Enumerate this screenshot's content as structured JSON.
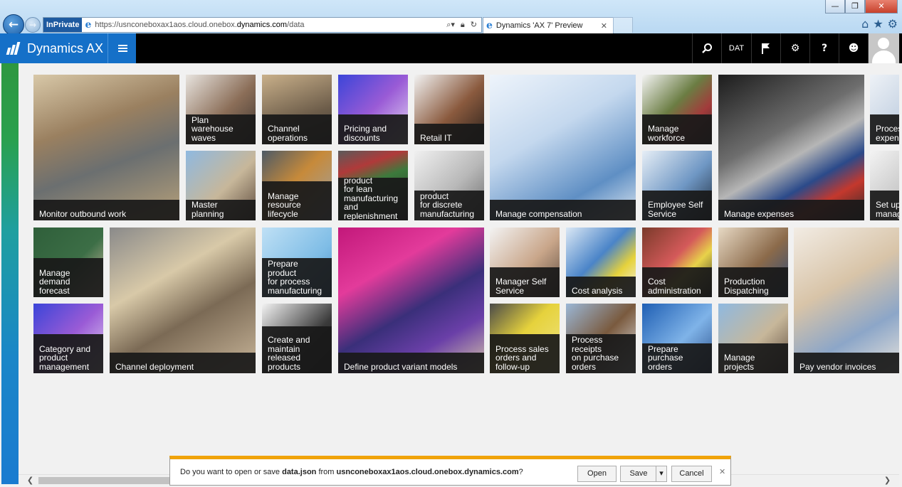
{
  "browser": {
    "inprivate": "InPrivate",
    "url_prefix": "https://usnconeboxax1aos.cloud.onebox.",
    "url_domain": "dynamics.com",
    "url_path": "/data",
    "tab_title": "Dynamics 'AX 7' Preview",
    "window_buttons": {
      "minimize": "—",
      "restore": "❐",
      "close": "✕"
    },
    "toolbar_icons": [
      "home-icon",
      "favorites-star-icon",
      "tools-gear-icon"
    ]
  },
  "appbar": {
    "title": "Dynamics AX",
    "company": "DAT",
    "icons": [
      "search-icon",
      "flag-icon",
      "gear-icon",
      "help-icon",
      "feedback-smiley-icon",
      "user-avatar"
    ]
  },
  "tiles": [
    {
      "label": "Monitor outbound work"
    },
    {
      "label": "Plan warehouse\nwaves"
    },
    {
      "label": "Channel\noperations"
    },
    {
      "label": "Pricing and\ndiscounts"
    },
    {
      "label": "Retail IT"
    },
    {
      "label": "Manage compensation"
    },
    {
      "label": "Manage\nworkforce"
    },
    {
      "label": "Manage expenses"
    },
    {
      "label": "Process\nexpens"
    },
    {
      "label": "Master planning"
    },
    {
      "label": "Manage\nresource\nlifecycle"
    },
    {
      "label": "Prepare product\nfor lean\nmanufacturing\nand\nreplenishment"
    },
    {
      "label": "Prepare product\nfor discrete\nmanufacturing"
    },
    {
      "label": "Employee Self\nService"
    },
    {
      "label": "Set up\nmanag"
    },
    {
      "label": "Manage\ndemand\nforecast"
    },
    {
      "label": "Channel deployment"
    },
    {
      "label": "Prepare product\nfor process\nmanufacturing"
    },
    {
      "label": "Define product variant models"
    },
    {
      "label": "Manager Self\nService"
    },
    {
      "label": "Cost analysis"
    },
    {
      "label": "Cost\nadministration"
    },
    {
      "label": "Production\nDispatching"
    },
    {
      "label": "Pay vendor invoices"
    },
    {
      "label": "Category and\nproduct\nmanagement"
    },
    {
      "label": "Create and\nmaintain\nreleased\nproducts"
    },
    {
      "label": "Process sales\norders and\nfollow-up"
    },
    {
      "label": "Process receipts\non purchase\norders"
    },
    {
      "label": "Prepare\npurchase orders"
    },
    {
      "label": "Manage\nprojects"
    }
  ],
  "download_bar": {
    "prefix": "Do you want to open or save ",
    "filename": "data.json",
    "middle": " from ",
    "source": "usnconeboxax1aos.cloud.onebox.dynamics.com",
    "suffix": "?",
    "open": "Open",
    "save": "Save",
    "cancel": "Cancel",
    "dropdown_arrow": "▾",
    "close": "✕"
  }
}
